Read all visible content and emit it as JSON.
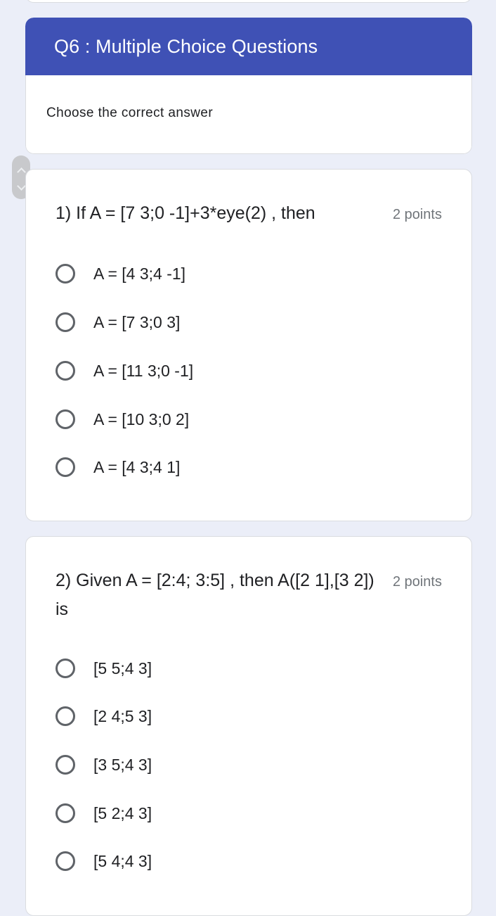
{
  "section": {
    "title": "Q6 : Multiple Choice Questions",
    "description": "Choose the correct answer"
  },
  "questions": [
    {
      "title": "1) If A = [7 3;0 -1]+3*eye(2) , then",
      "points": "2 points",
      "options": [
        "A = [4 3;4 -1]",
        "A = [7 3;0 3]",
        "A = [11 3;0 -1]",
        "A = [10 3;0 2]",
        "A = [4 3;4 1]"
      ],
      "selected": null
    },
    {
      "title": "2) Given A = [2:4; 3:5] , then A([2 1],[3 2]) is",
      "points": "2 points",
      "options": [
        "[5 5;4 3]",
        "[2 4;5 3]",
        "[3 5;4 3]",
        "[5 2;4 3]",
        "[5 4;4 3]"
      ],
      "selected": null
    }
  ],
  "colors": {
    "header": "#3f51b5",
    "background": "#ebeef8",
    "radio": "#5f6368",
    "points": "#70757a"
  },
  "icons": {
    "scroll_up": "chevron-up-icon",
    "scroll_down": "chevron-down-icon",
    "radio": "radio-unchecked-icon"
  }
}
